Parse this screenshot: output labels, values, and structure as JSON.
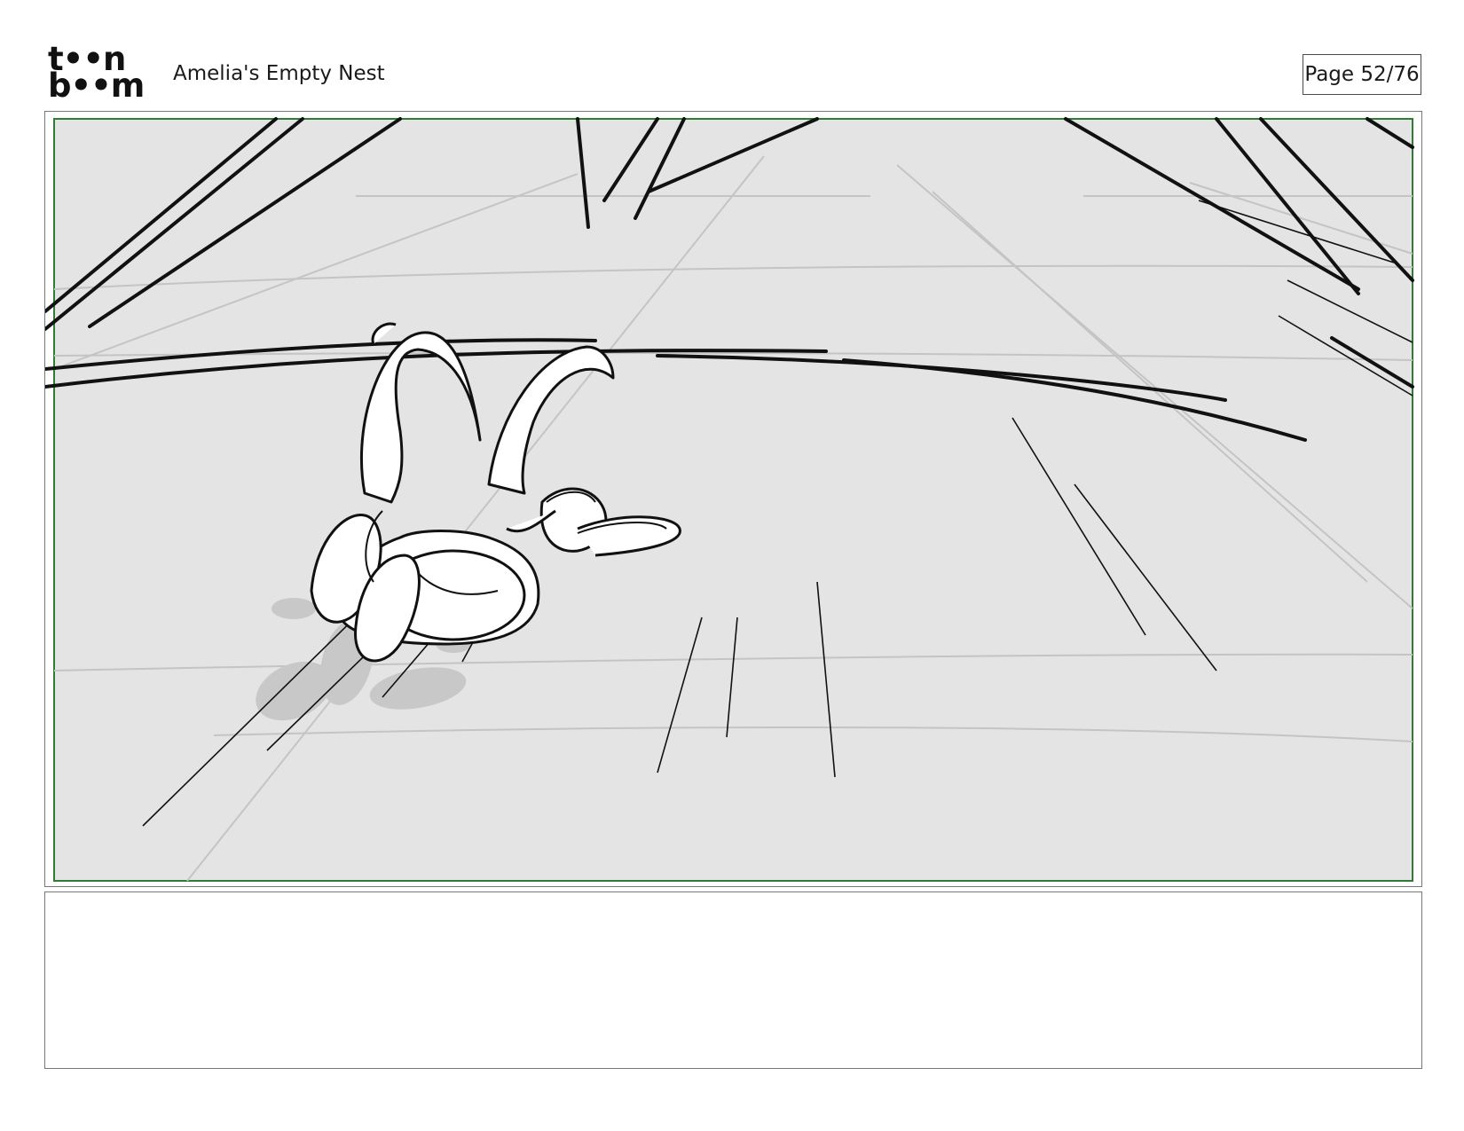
{
  "header": {
    "logo": {
      "line1": "t••n",
      "line2": "b••m",
      "icon": "toon-boom-logo"
    },
    "project_title": "Amelia's Empty Nest",
    "page_indicator": "Page 52/76"
  },
  "panel": {
    "image": "storyboard-sketch-creature-running",
    "safe_area_color": "#2e7d32",
    "background_color": "#e4e4e4"
  },
  "notes": {
    "text": ""
  }
}
